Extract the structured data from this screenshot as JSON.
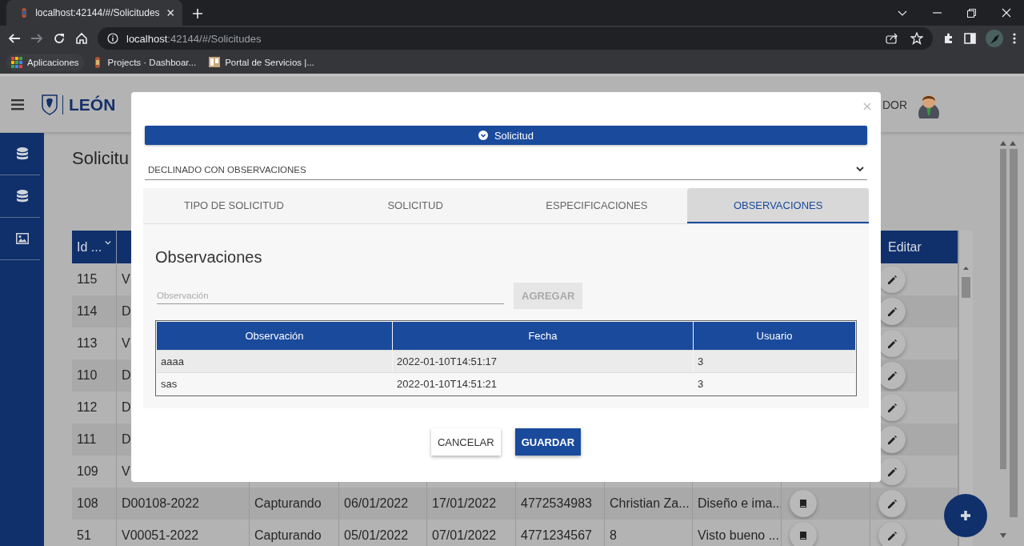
{
  "browser": {
    "tab_title": "localhost:42144/#/Solicitudes",
    "url_host": "localhost",
    "url_path": ":42144/#/Solicitudes",
    "forward_disabled": true,
    "bookmarks": [
      {
        "label": "Aplicaciones",
        "kind": "apps"
      },
      {
        "label": "Projects · Dashboar...",
        "kind": "site"
      },
      {
        "label": "Portal de Servicios |...",
        "kind": "page"
      }
    ]
  },
  "app_header": {
    "logo_text": "LEÓN",
    "user_label": "DOR"
  },
  "sidebar": {
    "items": [
      {
        "kind": "database"
      },
      {
        "kind": "database"
      },
      {
        "kind": "image"
      }
    ]
  },
  "page": {
    "title": "Solicitu",
    "table": {
      "id_column": "Id ...",
      "edit_column": "Editar",
      "rows": [
        {
          "id": "115",
          "column_2": "V"
        },
        {
          "id": "114",
          "column_2": "D"
        },
        {
          "id": "113",
          "column_2": "V"
        },
        {
          "id": "110",
          "column_2": "D"
        },
        {
          "id": "112",
          "column_2": "D"
        },
        {
          "id": "111",
          "column_2": "D"
        },
        {
          "id": "109",
          "column_2": "V"
        },
        {
          "id": "108",
          "column_2": "D00108-2022",
          "column_3": "Capturando",
          "column_4": "06/01/2022",
          "column_5": "17/01/2022",
          "column_6": "4772534983",
          "column_7": "Christian Za...",
          "column_8": "Diseño e ima..."
        },
        {
          "id": "51",
          "column_2": "V00051-2022",
          "column_3": "Capturando",
          "column_4": "05/01/2022",
          "column_5": "07/01/2022",
          "column_6": "4771234567",
          "column_7": "8",
          "column_8": "Visto bueno ..."
        }
      ]
    }
  },
  "modal": {
    "section_title": "Solicitud",
    "status_select": "DECLINADO CON OBSERVACIONES",
    "tabs": [
      {
        "label": "TIPO DE SOLICITUD",
        "selected": false
      },
      {
        "label": "SOLICITUD",
        "selected": false
      },
      {
        "label": "ESPECIFICACIONES",
        "selected": false
      },
      {
        "label": "OBSERVACIONES",
        "selected": true
      }
    ],
    "heading": "Observaciones",
    "input": {
      "placeholder": "Observación"
    },
    "add_button": {
      "label": "AGREGAR",
      "disabled": true
    },
    "table": {
      "columns": [
        "Observación",
        "Fecha",
        "Usuario"
      ],
      "rows": [
        [
          "aaaa",
          "2022-01-10T14:51:17",
          "3"
        ],
        [
          "sas",
          "2022-01-10T14:51:21",
          "3"
        ]
      ]
    },
    "buttons": [
      {
        "label": "CANCELAR",
        "kind": "secondary"
      },
      {
        "label": "GUARDAR",
        "kind": "primary"
      }
    ]
  }
}
